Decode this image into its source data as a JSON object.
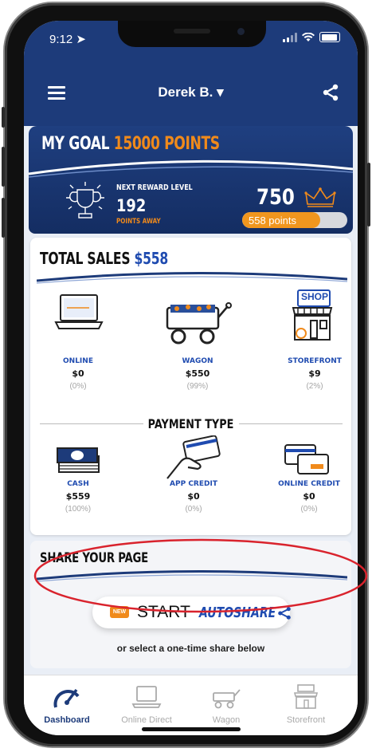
{
  "status": {
    "time": "9:12"
  },
  "nav": {
    "user_name": "Derek B. ▾",
    "menu_icon": "hamburger-icon",
    "share_icon": "share-icon"
  },
  "goal": {
    "title_prefix": "MY GOAL",
    "title_points": "15000 POINTS",
    "next_label": "NEXT REWARD LEVEL",
    "points_away": "192",
    "points_away_label": "POINTS AWAY",
    "level_points": "750",
    "progress_text": "558 points",
    "progress_fraction": 0.74
  },
  "sales": {
    "title": "TOTAL SALES",
    "amount": "$558",
    "channels": [
      {
        "label": "ONLINE",
        "value": "$0",
        "percent": "(0%)"
      },
      {
        "label": "WAGON",
        "value": "$550",
        "percent": "(99%)"
      },
      {
        "label": "STOREFRONT",
        "value": "$9",
        "percent": "(2%)"
      }
    ],
    "payment_title": "PAYMENT TYPE",
    "payments": [
      {
        "label": "CASH",
        "value": "$559",
        "percent": "(100%)"
      },
      {
        "label": "APP CREDIT",
        "value": "$0",
        "percent": "(0%)"
      },
      {
        "label": "ONLINE CREDIT",
        "value": "$0",
        "percent": "(0%)"
      }
    ],
    "shop_sign": "SHOP"
  },
  "share": {
    "title": "SHARE YOUR PAGE",
    "badge": "NEW",
    "start": "START",
    "autoshare": "AUTOSHARE",
    "onetime": "or select a one-time share below"
  },
  "tabs": [
    {
      "label": "Dashboard",
      "active": true
    },
    {
      "label": "Online Direct",
      "active": false
    },
    {
      "label": "Wagon",
      "active": false
    },
    {
      "label": "Storefront",
      "active": false
    }
  ],
  "colors": {
    "brand_blue": "#1d3b7a",
    "accent_orange": "#f08a1b",
    "link_blue": "#1f4bb0",
    "highlight_red": "#d9232d"
  }
}
